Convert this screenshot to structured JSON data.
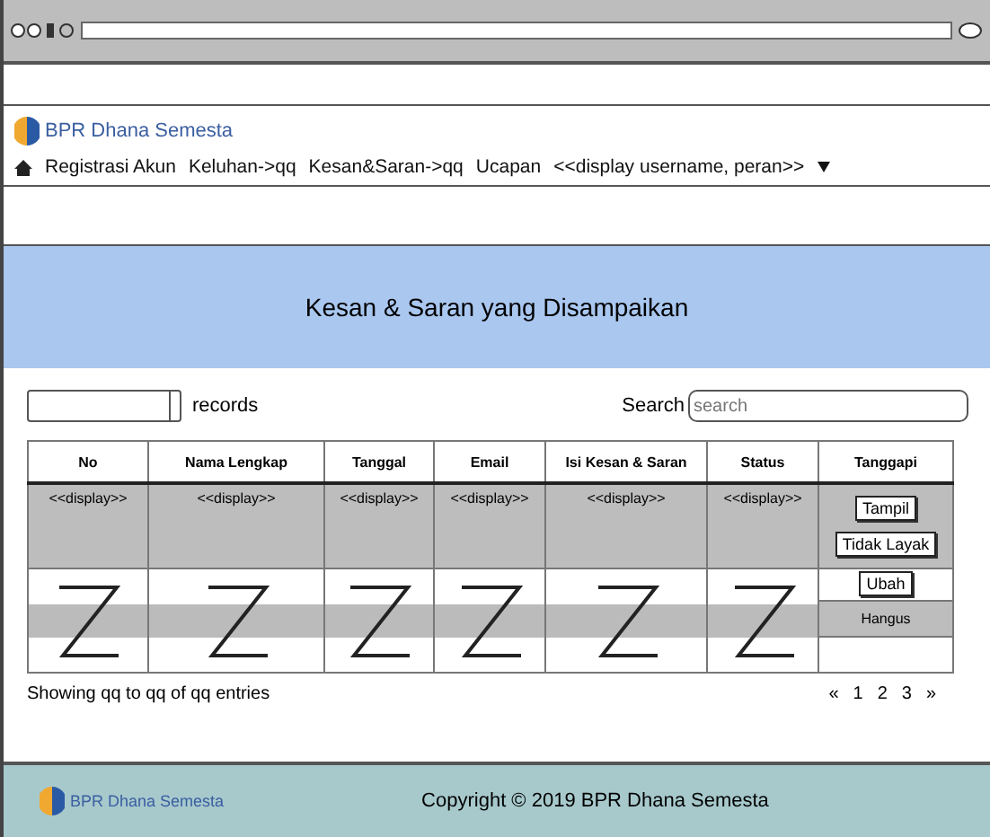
{
  "brand": {
    "name": "BPR Dhana Semesta"
  },
  "nav": {
    "items": [
      "Registrasi Akun",
      "Keluhan->qq",
      "Kesan&Saran->qq",
      "Ucapan",
      "<<display username, peran>>"
    ]
  },
  "banner": {
    "title": "Kesan & Saran yang Disampaikan"
  },
  "controls": {
    "records_label": "records",
    "search_label": "Search",
    "search_placeholder": "search"
  },
  "table": {
    "columns": [
      "No",
      "Nama Lengkap",
      "Tanggal",
      "Email",
      "Isi Kesan & Saran",
      "Status",
      "Tanggapi"
    ],
    "rows": [
      {
        "cells": [
          "<<display>>",
          "<<display>>",
          "<<display>>",
          "<<display>>",
          "<<display>>",
          "<<display>>"
        ],
        "actions": [
          "Tampil",
          "Tidak Layak"
        ]
      }
    ],
    "last_actions": {
      "button": "Ubah",
      "text": "Hangus"
    }
  },
  "footer_info": {
    "entries": "Showing qq to qq of qq entries",
    "pages": [
      "«",
      "1",
      "2",
      "3",
      "»"
    ]
  },
  "footer": {
    "brand": "BPR Dhana Semesta",
    "copyright": "Copyright © 2019 BPR Dhana Semesta"
  }
}
